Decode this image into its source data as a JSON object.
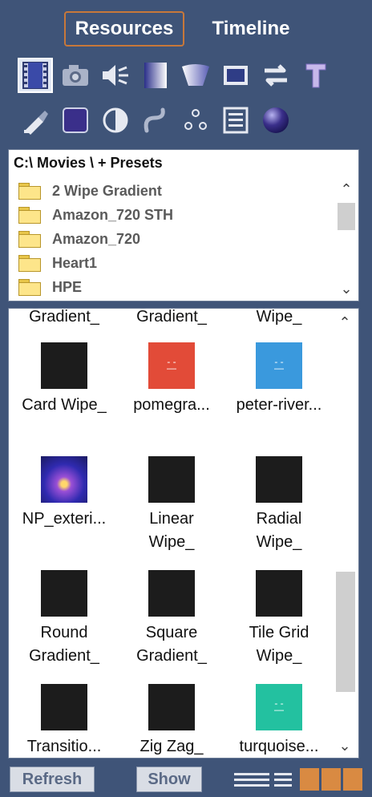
{
  "tabs": {
    "resources": "Resources",
    "timeline": "Timeline"
  },
  "toolbar": {
    "row1": [
      "film-icon",
      "camera-icon",
      "speaker-icon",
      "gradient-icon",
      "shape-icon",
      "window-icon",
      "swap-icon",
      "text-icon"
    ],
    "row2": [
      "brush-icon",
      "square-icon",
      "contrast-icon",
      "curve-icon",
      "particles-icon",
      "list-icon",
      "sphere-icon"
    ]
  },
  "folders": {
    "path": "C:\\ Movies \\  + Presets",
    "items": [
      "2 Wipe Gradient",
      "Amazon_720 STH",
      "Amazon_720",
      "Heart1",
      "HPE"
    ]
  },
  "thumbs": {
    "top_row": [
      "Gradient_",
      "Gradient_",
      "Wipe_"
    ],
    "items": [
      {
        "l1": "Card Wipe_",
        "l2": ""
      },
      {
        "l1": "pomegra...",
        "l2": ""
      },
      {
        "l1": "peter-river...",
        "l2": ""
      },
      {
        "l1": "NP_exteri...",
        "l2": ""
      },
      {
        "l1": "Linear",
        "l2": "Wipe_"
      },
      {
        "l1": "Radial",
        "l2": "Wipe_"
      },
      {
        "l1": "Round",
        "l2": "Gradient_"
      },
      {
        "l1": "Square",
        "l2": "Gradient_"
      },
      {
        "l1": "Tile Grid",
        "l2": "Wipe_"
      },
      {
        "l1": "Transitio...",
        "l2": ""
      },
      {
        "l1": "Zig Zag_",
        "l2": ""
      },
      {
        "l1": "turquoise...",
        "l2": ""
      }
    ]
  },
  "bottom": {
    "refresh": "Refresh",
    "show": "Show"
  },
  "colors": {
    "background": "#3f5478",
    "accent": "#c8783a",
    "grid_view": "#d98a42"
  }
}
